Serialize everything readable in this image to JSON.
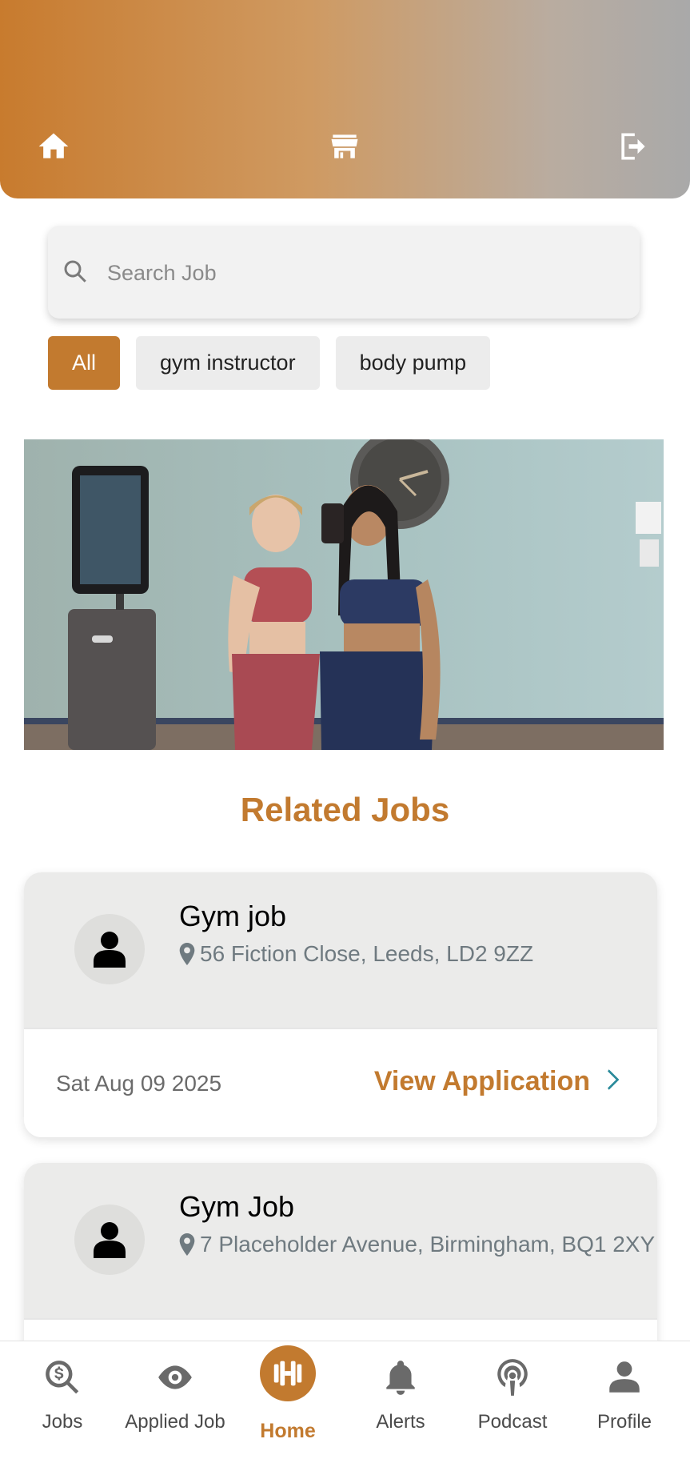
{
  "header": {
    "icons": [
      "home-icon",
      "store-icon",
      "logout-icon"
    ]
  },
  "search": {
    "placeholder": "Search Job",
    "value": ""
  },
  "filters": {
    "chips": [
      "All",
      "gym instructor",
      "body pump"
    ],
    "active": "All"
  },
  "related_jobs": {
    "title": "Related Jobs",
    "jobs": [
      {
        "title": "Gym job",
        "location": "56 Fiction Close, Leeds, LD2 9ZZ",
        "date": "Sat Aug 09 2025",
        "action": "View Application"
      },
      {
        "title": "Gym Job",
        "location": "7 Placeholder Avenue, Birmingham, BQ1 2XY"
      }
    ]
  },
  "bottom_nav": {
    "items": [
      {
        "label": "Jobs",
        "icon": "search-dollar-icon"
      },
      {
        "label": "Applied Job",
        "icon": "eye-icon"
      },
      {
        "label": "Home",
        "icon": "dumbbell-icon"
      },
      {
        "label": "Alerts",
        "icon": "bell-icon"
      },
      {
        "label": "Podcast",
        "icon": "podcast-icon"
      },
      {
        "label": "Profile",
        "icon": "person-icon"
      }
    ],
    "active": "Home"
  },
  "colors": {
    "accent": "#c27a2f",
    "chevron": "#2a8a9a"
  }
}
